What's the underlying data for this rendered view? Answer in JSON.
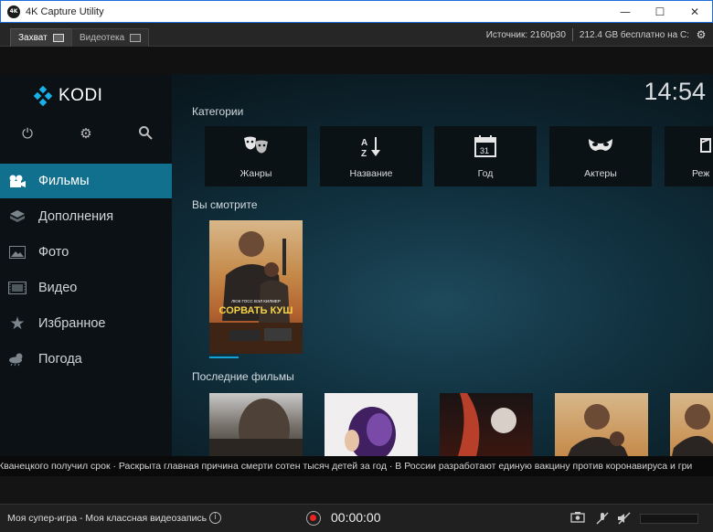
{
  "window": {
    "title": "4K Capture Utility",
    "app_icon_text": "4K",
    "minimize_glyph": "—",
    "maximize_glyph": "☐",
    "close_glyph": "✕"
  },
  "toolbar": {
    "tabs": [
      {
        "label": "Захват",
        "icon": "capture-icon",
        "active": true
      },
      {
        "label": "Видеотека",
        "icon": "library-icon",
        "active": false
      }
    ],
    "source": "Источник: 2160p30",
    "free_space": "212.4 GB бесплатно на C:",
    "settings_icon": "gear-icon"
  },
  "kodi": {
    "logo": "KODI",
    "clock": "14:54",
    "system_icons": [
      "power-icon",
      "settings-icon",
      "search-icon"
    ],
    "menu": [
      {
        "label": "Фильмы",
        "icon": "movies-icon",
        "selected": true
      },
      {
        "label": "Дополнения",
        "icon": "addons-icon",
        "selected": false
      },
      {
        "label": "Фото",
        "icon": "photo-icon",
        "selected": false
      },
      {
        "label": "Видео",
        "icon": "video-icon",
        "selected": false
      },
      {
        "label": "Избранное",
        "icon": "star-icon",
        "selected": false
      },
      {
        "label": "Погода",
        "icon": "weather-icon",
        "selected": false
      }
    ],
    "categories_title": "Категории",
    "categories": [
      {
        "label": "Жанры",
        "icon": "masks-icon"
      },
      {
        "label": "Название",
        "icon": "sort-az-icon"
      },
      {
        "label": "Год",
        "icon": "calendar-icon"
      },
      {
        "label": "Актеры",
        "icon": "mask-icon"
      },
      {
        "label": "Реж",
        "icon": "director-icon"
      }
    ],
    "calendar_day": "31",
    "watching_title": "Вы смотрите",
    "watching_poster": {
      "actors": "ЛЮК ГОСС  ВЭЛ КИЛМЕР",
      "title": "СОРВАТЬ КУШ",
      "progress": 0.3
    },
    "recent_title": "Последние фильмы"
  },
  "ticker": {
    "text": "Кванецкого получил срок · Раскрыта главная причина смерти сотен тысяч детей за год · В России разработают единую вакцину против коронавируса и гри"
  },
  "bottom": {
    "recording_name": "Моя супер-игра - Моя классная видеозапись",
    "timer": "00:00:00",
    "icons": [
      "screenshot-icon",
      "mic-muted-icon",
      "audio-muted-icon"
    ]
  },
  "colors": {
    "accent": "#12708f",
    "titlebar_border": "#1e6fd9",
    "record": "#e22222"
  }
}
